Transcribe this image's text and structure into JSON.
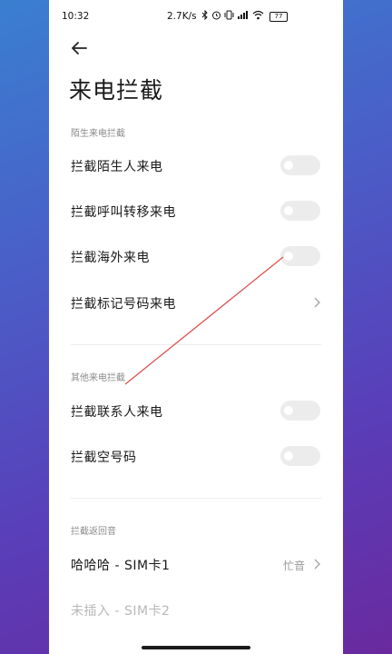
{
  "status_bar": {
    "time": "10:32",
    "network_speed": "2.7K/s",
    "icons": [
      "bluetooth-icon",
      "alarm-icon",
      "vibrate-icon",
      "signal-icon",
      "wifi-icon"
    ],
    "battery": "77"
  },
  "header": {
    "back_icon": "arrow-left-icon",
    "title": "来电拦截"
  },
  "sections": [
    {
      "header": "陌生来电拦截",
      "items": [
        {
          "label": "拦截陌生人来电",
          "control": "toggle",
          "on": false
        },
        {
          "label": "拦截呼叫转移来电",
          "control": "toggle",
          "on": false
        },
        {
          "label": "拦截海外来电",
          "control": "toggle",
          "on": false
        },
        {
          "label": "拦截标记号码来电",
          "control": "chevron"
        }
      ]
    },
    {
      "header": "其他来电拦截",
      "items": [
        {
          "label": "拦截联系人来电",
          "control": "toggle",
          "on": false
        },
        {
          "label": "拦截空号码",
          "control": "toggle",
          "on": false
        }
      ]
    },
    {
      "header": "拦截返回音",
      "items": [
        {
          "label": "哈哈哈 - SIM卡1",
          "value": "忙音",
          "control": "chevron"
        },
        {
          "label": "未插入 - SIM卡2",
          "disabled": true
        }
      ]
    }
  ],
  "colors": {
    "annotation_line": "#d9534f",
    "toggle_off": "#ececec",
    "background_gradient_start": "#3a7fd0",
    "background_gradient_end": "#6a2a9e"
  }
}
